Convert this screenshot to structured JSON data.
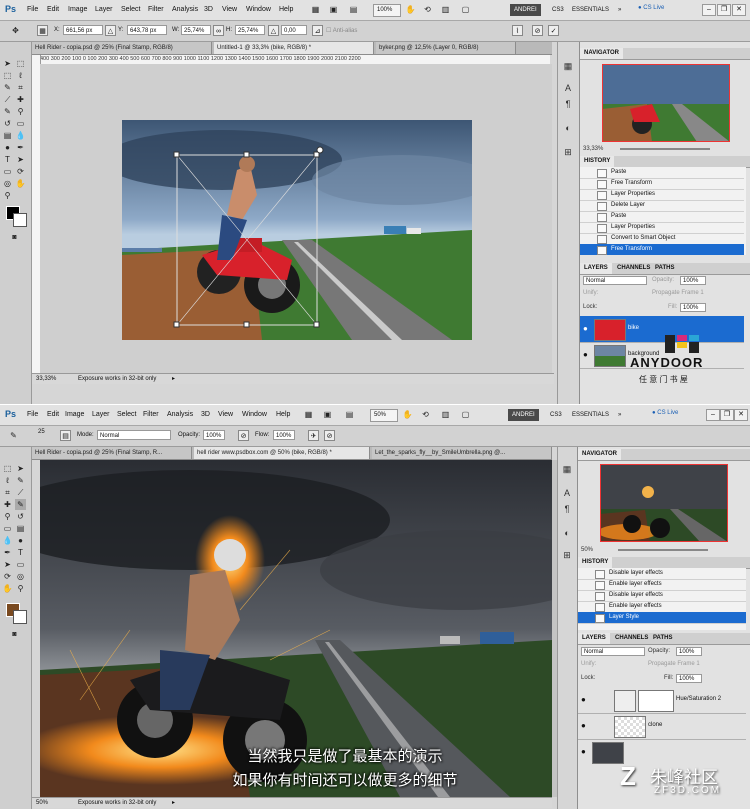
{
  "top": {
    "menu": [
      "File",
      "Edit",
      "Image",
      "Layer",
      "Select",
      "Filter",
      "Analysis",
      "3D",
      "View",
      "Window",
      "Help"
    ],
    "zoom_select": "100%",
    "workspace_active": "ANDREI",
    "workspace_other": "CS3",
    "workspace_essentials": "ESSENTIALS",
    "cs_live": "CS Live",
    "options": {
      "x_label": "X:",
      "x_value": "661,56 px",
      "y_label": "Y:",
      "y_value": "643,78 px",
      "w_label": "W:",
      "w_value": "25,74%",
      "h_label": "H:",
      "h_value": "25,74%",
      "angle_value": "0,00",
      "antialias": "Anti-alias"
    },
    "tabs": [
      "Hell Rider - copia.psd @ 25% (Final Stamp, RGB/8)",
      "Untitled-1 @ 33,3% (bike, RGB/8) *",
      "byker.png @ 12,5% (Layer 0, RGB/8)"
    ],
    "ruler_text": "400  300  200  100    0    100  200  300  400  500  600  700  800  900  1000 1100 1200 1300 1400 1500 1600 1700 1800 1900 2000 2100 2200",
    "status_zoom": "33,33%",
    "status_text": "Exposure works in 32-bit only",
    "navigator": {
      "title": "NAVIGATOR",
      "zoom": "33,33%"
    },
    "history": {
      "title": "HISTORY",
      "items": [
        "Paste",
        "Free Transform",
        "Layer Properties",
        "Delete Layer",
        "Paste",
        "Layer Properties",
        "Convert to Smart Object",
        "Free Transform"
      ]
    },
    "layers": {
      "tabs": [
        "LAYERS",
        "CHANNELS",
        "PATHS"
      ],
      "blend": "Normal",
      "opacity_label": "Opacity:",
      "opacity": "100%",
      "unify": "Unify:",
      "propagate": "Propagate Frame 1",
      "lock": "Lock:",
      "fill_label": "Fill:",
      "fill": "100%",
      "items": [
        "bike",
        "background"
      ]
    }
  },
  "watermark_top": {
    "brand": "ANYDOOR",
    "sub": "任 意 门 书 屋"
  },
  "bottom": {
    "menu": [
      "File",
      "Edit",
      "Image",
      "Layer",
      "Select",
      "Filter",
      "Analysis",
      "3D",
      "View",
      "Window",
      "Help"
    ],
    "zoom_select": "50%",
    "workspace_active": "ANDREI",
    "workspace_other": "CS3",
    "workspace_essentials": "ESSENTIALS",
    "cs_live": "CS Live",
    "options": {
      "brush_size": "25",
      "mode_label": "Mode:",
      "mode": "Normal",
      "opacity_label": "Opacity:",
      "opacity": "100%",
      "flow_label": "Flow:",
      "flow": "100%"
    },
    "tabs": [
      "Hell Rider - copia.psd @ 25% (Final Stamp, R...",
      "hell rider www.psdbox.com @ 50% (bike, RGB/8) *",
      "Let_the_sparks_fly__by_SmileUmbrella.png @..."
    ],
    "status_zoom": "50%",
    "status_text": "Exposure works in 32-bit only",
    "navigator": {
      "title": "NAVIGATOR",
      "zoom": "50%"
    },
    "history": {
      "title": "HISTORY",
      "items": [
        "Disable layer effects",
        "Enable layer effects",
        "Disable layer effects",
        "Enable layer effects",
        "Layer Style"
      ]
    },
    "layers": {
      "tabs": [
        "LAYERS",
        "CHANNELS",
        "PATHS"
      ],
      "blend": "Normal",
      "opacity_label": "Opacity:",
      "opacity": "100%",
      "unify": "Unify:",
      "propagate": "Propagate Frame 1",
      "lock": "Lock:",
      "fill_label": "Fill:",
      "fill": "100%",
      "items": [
        "Hue/Saturation 2",
        "clone"
      ]
    },
    "subtitles": [
      "当然我只是做了最基本的演示",
      "如果你有时间还可以做更多的细节"
    ]
  },
  "watermark_bottom": {
    "brand": "朱峰社区",
    "url": "ZF3D.COM"
  },
  "colors": {
    "selection_blue": "#1b6bd0",
    "brush_color": "#7a4a20"
  }
}
